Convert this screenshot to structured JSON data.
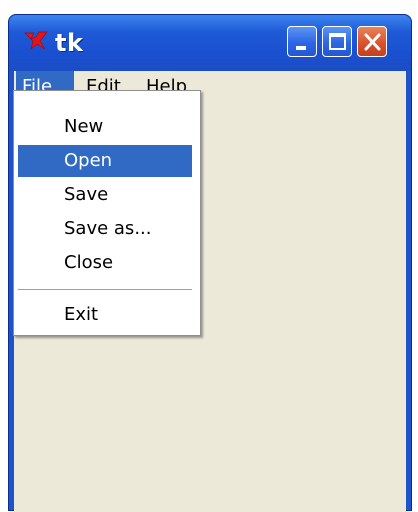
{
  "window": {
    "title": "tk",
    "controls": {
      "minimize": "minimize-icon",
      "maximize": "maximize-icon",
      "close": "close-icon"
    },
    "accent": "#245edb",
    "close_color": "#d9532f"
  },
  "menubar": {
    "items": [
      {
        "label": "File",
        "active": true
      },
      {
        "label": "Edit",
        "active": false
      },
      {
        "label": "Help",
        "active": false
      }
    ]
  },
  "file_menu": {
    "items": [
      {
        "label": "New",
        "highlighted": false
      },
      {
        "label": "Open",
        "highlighted": true
      },
      {
        "label": "Save",
        "highlighted": false
      },
      {
        "label": "Save as...",
        "highlighted": false
      },
      {
        "label": "Close",
        "highlighted": false
      },
      {
        "label": "Exit",
        "highlighted": false
      }
    ],
    "highlight_color": "#316ac5"
  }
}
